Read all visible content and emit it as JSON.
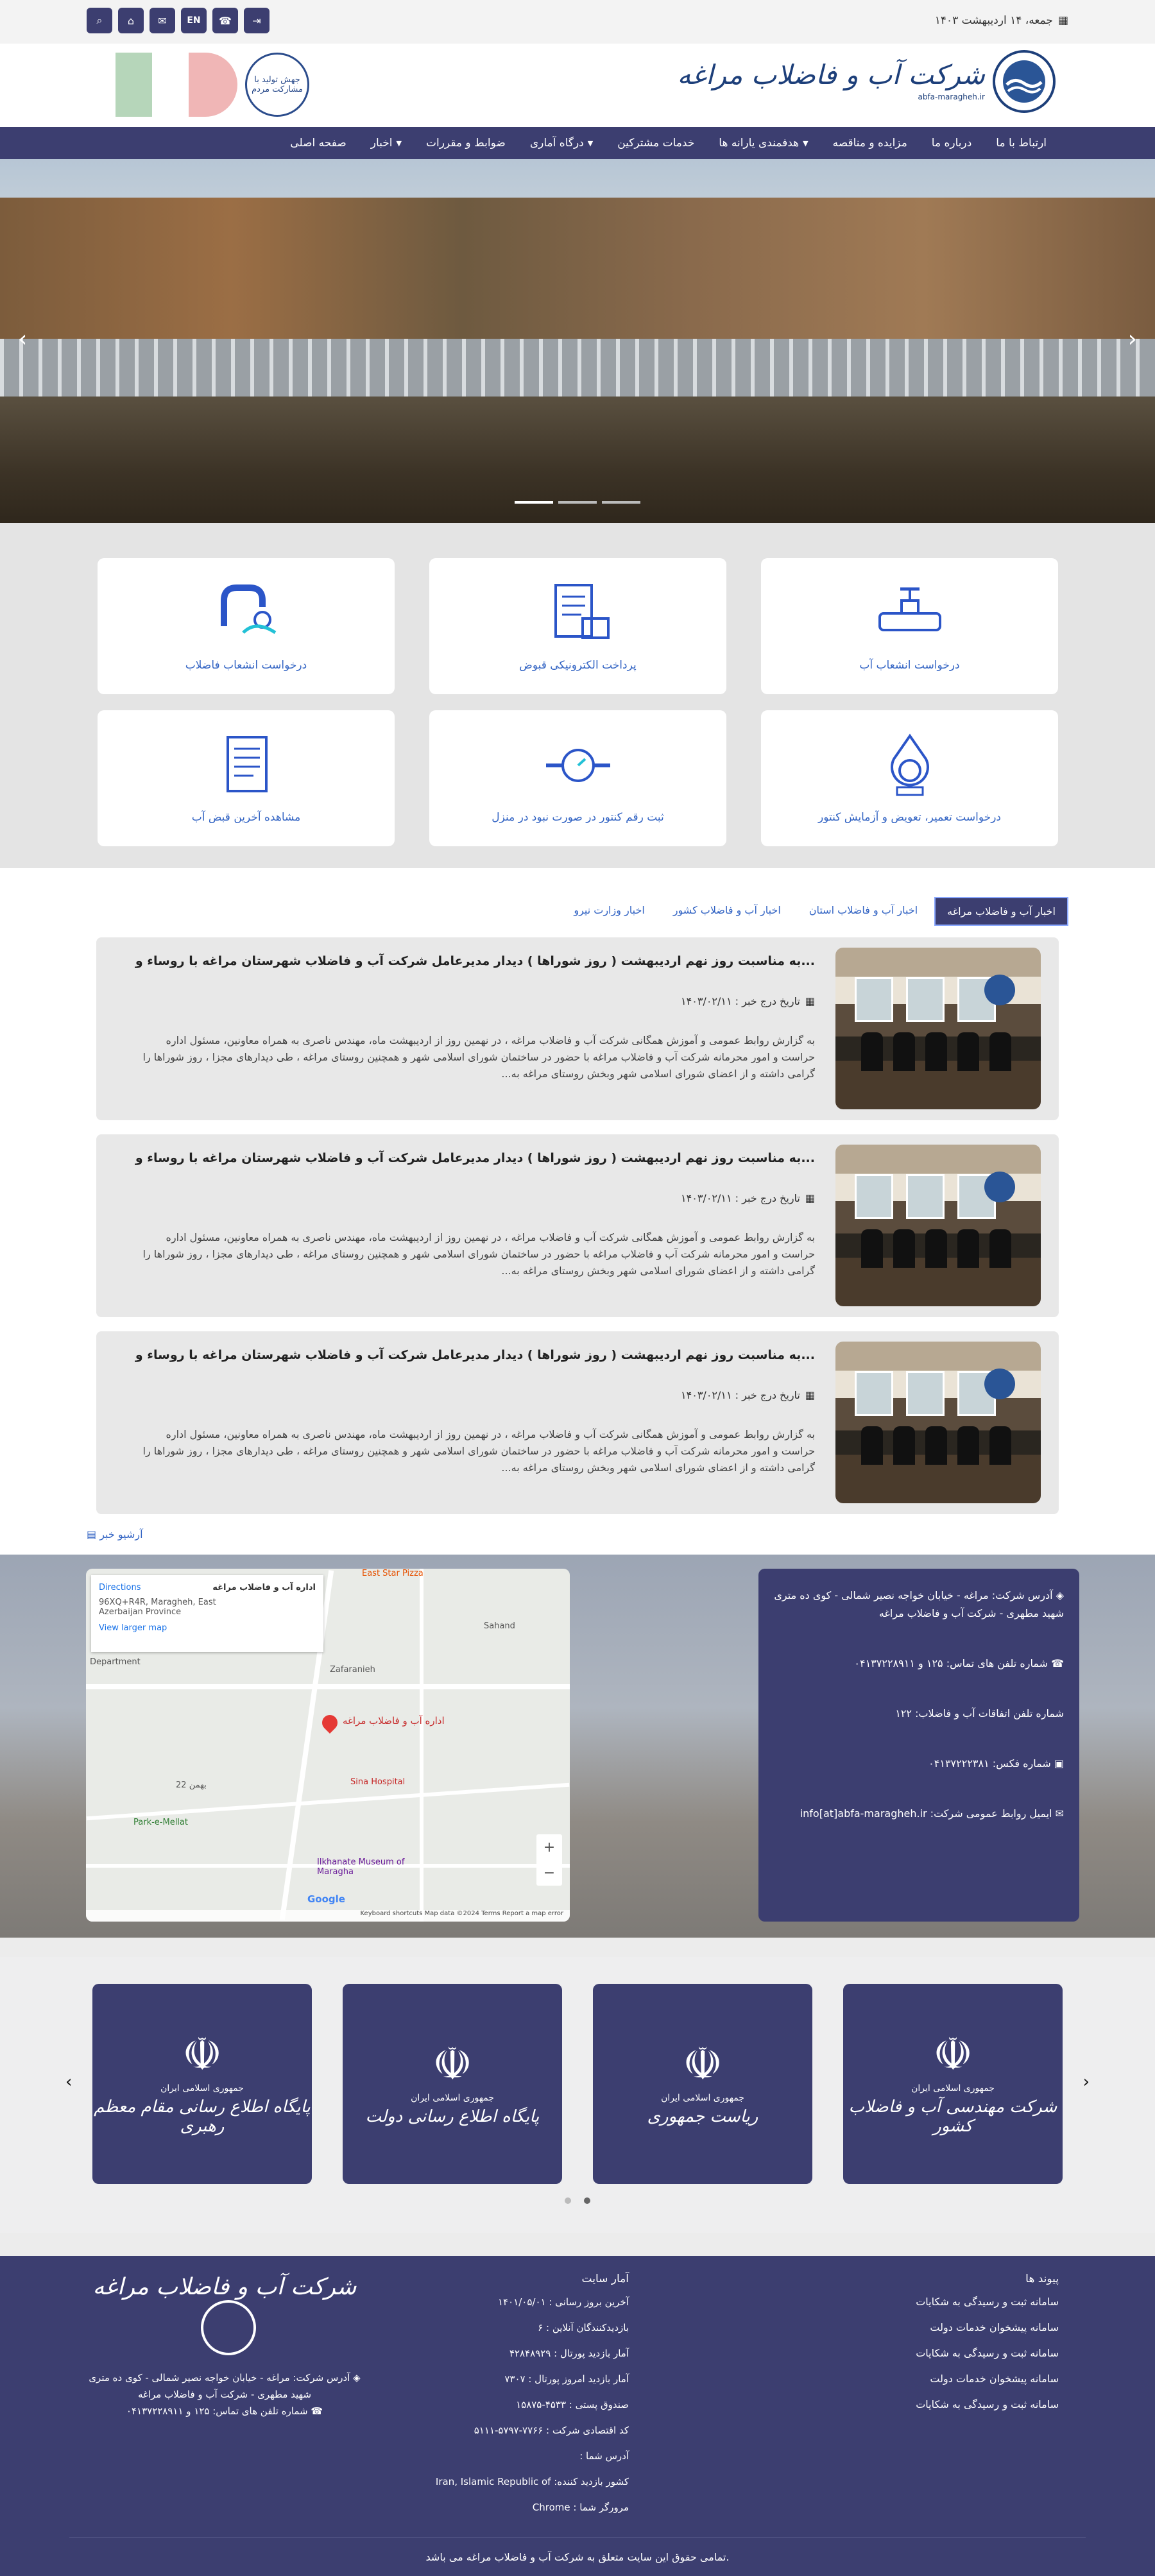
{
  "topbar": {
    "date": "جمعه، ۱۴ اردیبهشت ۱۴۰۳",
    "tools": {
      "search": "⌕",
      "home": "⌂",
      "mail": "✉",
      "lang": "EN",
      "phone": "☎",
      "login": "⇥"
    }
  },
  "header": {
    "brand_title": "شرکت آب و فاضلاب مراغه",
    "brand_sub": "abfa-maragheh.ir",
    "slogan": "جهش تولید با مشارکت مردم"
  },
  "nav": [
    {
      "label": "صفحه اصلی",
      "dropdown": false
    },
    {
      "label": "اخبار",
      "dropdown": true
    },
    {
      "label": "ضوابط و مقررات",
      "dropdown": false
    },
    {
      "label": "درگاه آماری",
      "dropdown": true
    },
    {
      "label": "خدمات مشترکین",
      "dropdown": false
    },
    {
      "label": "هدفمندی یارانه ها",
      "dropdown": true
    },
    {
      "label": "مزایده و مناقصه",
      "dropdown": false
    },
    {
      "label": "درباره ما",
      "dropdown": false
    },
    {
      "label": "ارتباط با ما",
      "dropdown": false
    }
  ],
  "hero": {
    "prev": "‹",
    "next": "›"
  },
  "services": [
    {
      "label": "درخواست انشعاب آب",
      "icon": "water-valve"
    },
    {
      "label": "پرداخت الکترونیکی قبوض",
      "icon": "bill-payment"
    },
    {
      "label": "درخواست انشعاب فاضلاب",
      "icon": "sewer-pipe"
    },
    {
      "label": "درخواست تعمیر، تعویض و آزمایش کنتور",
      "icon": "meter-drop"
    },
    {
      "label": "ثبت رقم کنتور در صورت نبود در منزل",
      "icon": "gauge"
    },
    {
      "label": "مشاهده آخرین قبض آب",
      "icon": "document"
    }
  ],
  "news": {
    "tabs": [
      "اخبار آب و فاضلاب مراغه",
      "اخبار آب و فاضلاب استان",
      "اخبار آب و فاضلاب کشور",
      "اخبار وزارت نیرو"
    ],
    "items": [
      {
        "title": "به مناسبت روز نهم اردیبهشت ( روز شوراها ) دیدار مدیرعامل شرکت آب و فاضلاب شهرستان مراغه با روساء و...",
        "date": "تاریخ درج خبر : ۱۴۰۳/۰۲/۱۱",
        "summary": "به گزارش روابط عمومی و آموزش همگانی شرکت آب و فاضلاب مراغه ، در نهمین روز از اردیبهشت ماه، مهندس ناصری به همراه معاونین، مسئول اداره حراست و امور محرمانه شرکت آب و فاضلاب مراغه با حضور در ساختمان شورای اسلامی شهر و همچنین روستای مراغه ، طی دیدارهای مجزا ، روز شوراها را گرامی داشته و از اعضای شورای اسلامی شهر وبخش روستای مراغه به..."
      },
      {
        "title": "به مناسبت روز نهم اردیبهشت ( روز شوراها ) دیدار مدیرعامل شرکت آب و فاضلاب شهرستان مراغه با روساء و...",
        "date": "تاریخ درج خبر : ۱۴۰۳/۰۲/۱۱",
        "summary": "به گزارش روابط عمومی و آموزش همگانی شرکت آب و فاضلاب مراغه ، در نهمین روز از اردیبهشت ماه، مهندس ناصری به همراه معاونین، مسئول اداره حراست و امور محرمانه شرکت آب و فاضلاب مراغه با حضور در ساختمان شورای اسلامی شهر و همچنین روستای مراغه ، طی دیدارهای مجزا ، روز شوراها را گرامی داشته و از اعضای شورای اسلامی شهر وبخش روستای مراغه به..."
      },
      {
        "title": "به مناسبت روز نهم اردیبهشت ( روز شوراها ) دیدار مدیرعامل شرکت آب و فاضلاب شهرستان مراغه با روساء و...",
        "date": "تاریخ درج خبر : ۱۴۰۳/۰۲/۱۱",
        "summary": "به گزارش روابط عمومی و آموزش همگانی شرکت آب و فاضلاب مراغه ، در نهمین روز از اردیبهشت ماه، مهندس ناصری به همراه معاونین، مسئول اداره حراست و امور محرمانه شرکت آب و فاضلاب مراغه با حضور در ساختمان شورای اسلامی شهر و همچنین روستای مراغه ، طی دیدارهای مجزا ، روز شوراها را گرامی داشته و از اعضای شورای اسلامی شهر وبخش روستای مراغه به..."
      }
    ],
    "archive": "آرشیو خبر"
  },
  "map": {
    "place_name": "اداره آب و فاضلاب مراغه",
    "address": "96XQ+R4R, Maragheh, East Azerbaijan Province",
    "directions": "Directions",
    "larger": "View larger map",
    "labels": [
      "East Star Pizza",
      "Department",
      "Zafaranieh",
      "Sahand",
      "Sina Hospital",
      "Park-e-Mellat",
      "Ilkhanate Museum of Maragha",
      "22 بهمن",
      "Google"
    ],
    "attribution": "Keyboard shortcuts   Map data ©2024   Terms   Report a map error",
    "zoom_in": "+",
    "zoom_out": "−"
  },
  "contact": {
    "address": "آدرس شرکت: مراغه - خیابان خواجه نصیر شمالی - کوی ده متری شهید مطهری - شرکت آب و فاضلاب مراغه",
    "phone": "شماره تلفن های تماس: ۱۲۵ و ۰۴۱۳۷۲۲۸۹۱۱",
    "incident": "شماره تلفن اتفاقات آب و فاضلاب: ۱۲۲",
    "fax": "شماره فکس: ۰۴۱۳۷۲۲۲۳۸۱",
    "email": "ایمیل روابط عمومی شرکت: info[at]abfa-maragheh.ir"
  },
  "links": {
    "cards": [
      {
        "small": "جمهوری اسلامی ایران",
        "big": "شرکت مهندسی آب و فاضلاب کشور"
      },
      {
        "small": "جمهوری اسلامی ایران",
        "big": "ریاست جمهوری"
      },
      {
        "small": "جمهوری اسلامی ایران",
        "big": "پایگاه اطلاع رسانی دولت"
      },
      {
        "small": "جمهوری اسلامی ایران",
        "big": "پایگاه اطلاع رسانی مقام معظم رهبری"
      }
    ],
    "prev": "‹",
    "next": "›"
  },
  "footer": {
    "links_title": "پیوند ها",
    "links": [
      "سامانه ثبت و رسیدگی به شکایات",
      "سامانه پیشخوان خدمات دولت",
      "سامانه ثبت و رسیدگی به شکایات",
      "سامانه پیشخوان خدمات دولت",
      "سامانه ثبت و رسیدگی به شکایات"
    ],
    "stats_title": "آمار سایت",
    "stats": [
      "آخرین بروز رسانی : ۱۴۰۱/۰۵/۰۱",
      "بازدیدکنندگان آنلاین : ۶",
      "آمار بازدید پورتال : ۴۲۸۴۸۹۲۹",
      "آمار بازدید امروز پورتال : ۷۳۰۷",
      "صندوق پستی : ۴۵۳۳-۱۵۸۷۵",
      "کد اقتصادی شرکت : ۷۷۶۶-۵۷۹۷-۵۱۱۱",
      "آدرس شما :",
      "کشور بازدید کننده: Iran, Islamic Republic of",
      "مرورگر شما : Chrome"
    ],
    "brand": "شرکت آب و فاضلاب مراغه",
    "address": "آدرس شرکت: مراغه - خیابان خواجه نصیر شمالی - کوی ده متری شهید مطهری - شرکت آب و فاضلاب مراغه",
    "phone": "شماره تلفن های تماس: ۱۲۵ و ۰۴۱۳۷۲۲۸۹۱۱",
    "copyright": "تمامی حقوق این سایت متعلق به شرکت آب و فاضلاب مراغه می باشد."
  }
}
